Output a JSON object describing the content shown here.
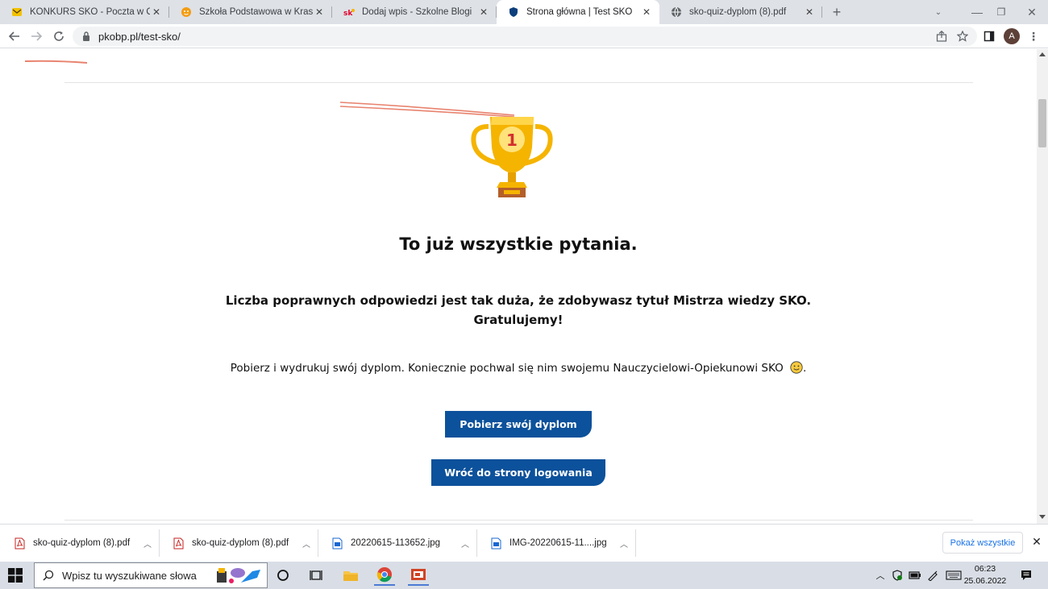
{
  "browser": {
    "tabs": [
      {
        "title": "KONKURS SKO - Poczta w Onet.p",
        "icon": "mail-favicon"
      },
      {
        "title": "Szkoła Podstawowa w Krasnej - '",
        "icon": "school-favicon"
      },
      {
        "title": "Dodaj wpis - Szkolne Blogi",
        "icon": "sko-favicon"
      },
      {
        "title": "Strona główna | Test SKO",
        "icon": "shield-favicon",
        "active": true
      },
      {
        "title": "sko-quiz-dyplom (8).pdf",
        "icon": "globe-favicon"
      }
    ],
    "url": "pkobp.pl/test-sko/",
    "avatar_letter": "A"
  },
  "page": {
    "heading": "To już wszystkie pytania.",
    "result_line1": "Liczba poprawnych odpowiedzi jest tak duża, że zdobywasz tytuł Mistrza wiedzy SKO.",
    "result_line2": "Gratulujemy!",
    "download_text": "Pobierz i wydrukuj swój dyplom. Koniecznie pochwal się nim swojemu Nauczycielowi-Opiekunowi SKO",
    "download_text_end": ".",
    "download_button": "Pobierz swój dyplom",
    "back_button": "Wróć do strony logowania",
    "trophy_number": "1"
  },
  "downloads": {
    "items": [
      {
        "name": "sko-quiz-dyplom (8).pdf",
        "type": "pdf"
      },
      {
        "name": "sko-quiz-dyplom (8).pdf",
        "type": "pdf"
      },
      {
        "name": "20220615-113652.jpg",
        "type": "jpg"
      },
      {
        "name": "IMG-20220615-11....jpg",
        "type": "jpg"
      }
    ],
    "show_all": "Pokaż wszystkie"
  },
  "taskbar": {
    "search_placeholder": "Wpisz tu wyszukiwane słowa",
    "time": "06:23",
    "date": "25.06.2022"
  },
  "colors": {
    "button_blue": "#0c519b",
    "trophy_gold": "#f5b400",
    "ribbon_red": "#e8836f"
  }
}
